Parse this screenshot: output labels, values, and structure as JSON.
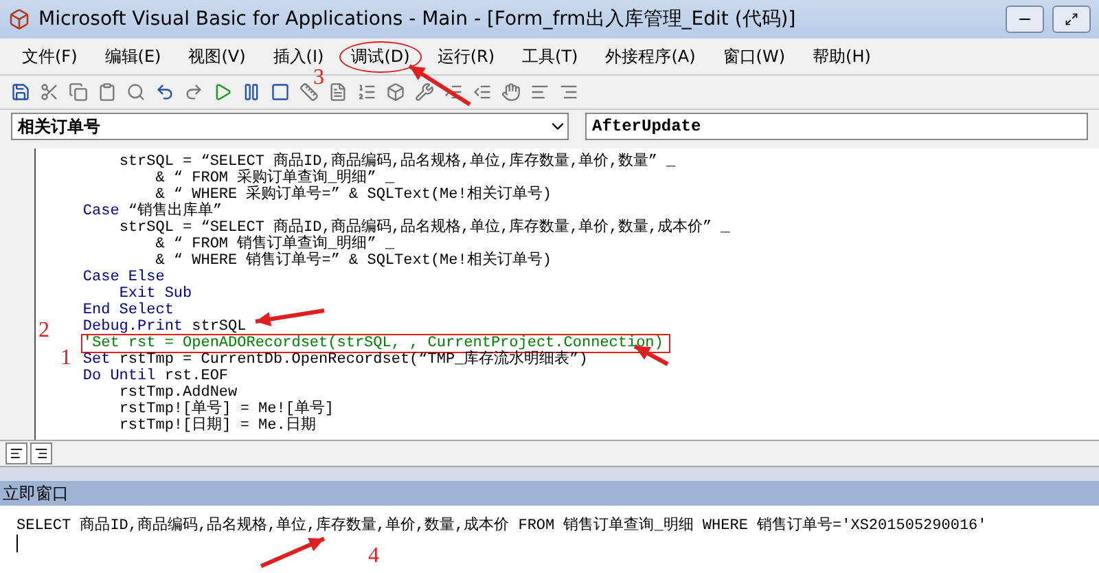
{
  "window": {
    "title": "Microsoft Visual Basic for Applications - Main - [Form_frm出入库管理_Edit (代码)]"
  },
  "menu": [
    {
      "label": "文件(F)",
      "selected": false
    },
    {
      "label": "编辑(E)",
      "selected": false
    },
    {
      "label": "视图(V)",
      "selected": false
    },
    {
      "label": "插入(I)",
      "selected": false
    },
    {
      "label": "调试(D)",
      "selected": true
    },
    {
      "label": "运行(R)",
      "selected": false
    },
    {
      "label": "工具(T)",
      "selected": false
    },
    {
      "label": "外接程序(A)",
      "selected": false
    },
    {
      "label": "窗口(W)",
      "selected": false
    },
    {
      "label": "帮助(H)",
      "selected": false
    }
  ],
  "object_select": {
    "value": "相关订单号"
  },
  "procedure_select": {
    "value": "AfterUpdate"
  },
  "code": [
    {
      "boxed": false,
      "parts": [
        {
          "kind": "text",
          "text": "        strSQL = “SELECT 商品ID,商品编码,品名规格,单位,库存数量,单价,数量” _"
        }
      ]
    },
    {
      "boxed": false,
      "parts": [
        {
          "kind": "text",
          "text": "            & “ FROM 采购订单查询_明细” _"
        }
      ]
    },
    {
      "boxed": false,
      "parts": [
        {
          "kind": "text",
          "text": "            & “ WHERE 采购订单号=” & SQLText(Me!相关订单号)"
        }
      ]
    },
    {
      "boxed": false,
      "parts": [
        {
          "kind": "keyword",
          "text": "    Case"
        },
        {
          "kind": "text",
          "text": " “销售出库单”"
        }
      ]
    },
    {
      "boxed": false,
      "parts": [
        {
          "kind": "text",
          "text": "        strSQL = “SELECT 商品ID,商品编码,品名规格,单位,库存数量,单价,数量,成本价” _"
        }
      ]
    },
    {
      "boxed": false,
      "parts": [
        {
          "kind": "text",
          "text": "            & “ FROM 销售订单查询_明细” _"
        }
      ]
    },
    {
      "boxed": false,
      "parts": [
        {
          "kind": "text",
          "text": "            & “ WHERE 销售订单号=” & SQLText(Me!相关订单号)"
        }
      ]
    },
    {
      "boxed": false,
      "parts": [
        {
          "kind": "keyword",
          "text": "    Case Else"
        }
      ]
    },
    {
      "boxed": false,
      "parts": [
        {
          "kind": "keyword",
          "text": "        Exit Sub"
        }
      ]
    },
    {
      "boxed": false,
      "parts": [
        {
          "kind": "keyword",
          "text": "    End Select"
        }
      ]
    },
    {
      "boxed": false,
      "parts": [
        {
          "kind": "keyword",
          "text": "    Debug.Print"
        },
        {
          "kind": "text",
          "text": " strSQL"
        }
      ]
    },
    {
      "boxed": true,
      "parts": [
        {
          "kind": "comment",
          "text": "    'Set rst = OpenADORecordset(strSQL, , CurrentProject.Connection)"
        }
      ]
    },
    {
      "boxed": false,
      "parts": [
        {
          "kind": "keyword",
          "text": "    Set"
        },
        {
          "kind": "text",
          "text": " rstTmp = CurrentDb.OpenRecordset(“TMP_库存流水明细表”)"
        }
      ]
    },
    {
      "boxed": false,
      "parts": [
        {
          "kind": "keyword",
          "text": "    Do Until"
        },
        {
          "kind": "text",
          "text": " rst.EOF"
        }
      ]
    },
    {
      "boxed": false,
      "parts": [
        {
          "kind": "text",
          "text": "        rstTmp.AddNew"
        }
      ]
    },
    {
      "boxed": false,
      "parts": [
        {
          "kind": "text",
          "text": "        rstTmp![单号] = Me![单号]"
        }
      ]
    },
    {
      "boxed": false,
      "parts": [
        {
          "kind": "text",
          "text": "        rstTmp![日期] = Me.日期"
        }
      ]
    }
  ],
  "immediate": {
    "title": "立即窗口",
    "lines": [
      "SELECT 商品ID,商品编码,品名规格,单位,库存数量,单价,数量,成本价 FROM 销售订单查询_明细 WHERE 销售订单号='XS201505290016'"
    ]
  },
  "annotations": [
    {
      "label": "3"
    },
    {
      "label": "2"
    },
    {
      "label": "1"
    },
    {
      "label": "4"
    }
  ]
}
